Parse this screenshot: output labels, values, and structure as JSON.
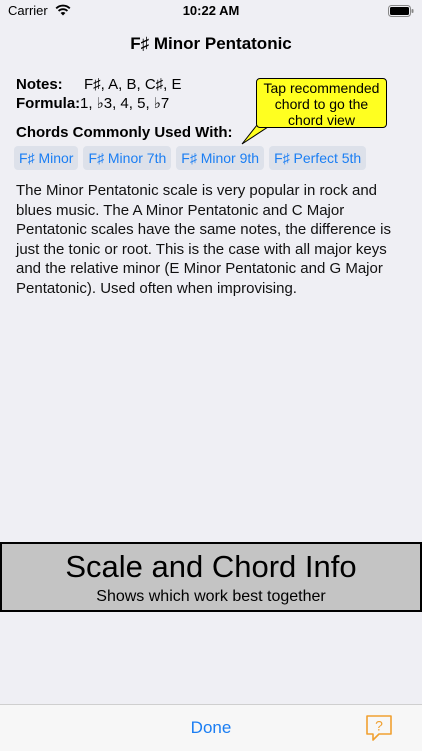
{
  "status_bar": {
    "carrier": "Carrier",
    "time": "10:22 AM",
    "icons": [
      "wifi-icon",
      "battery-icon"
    ]
  },
  "page": {
    "title": "F♯ Minor Pentatonic"
  },
  "scale_info": {
    "notes_label": "Notes:",
    "notes_value": "F♯, A, B, C♯, E",
    "formula_label": "Formula:",
    "formula_value": "1, ♭3, 4, 5, ♭7"
  },
  "chords": {
    "heading": "Chords Commonly Used With:",
    "items": [
      {
        "label": "F♯ Minor"
      },
      {
        "label": "F♯ Minor 7th"
      },
      {
        "label": "F♯ Minor 9th"
      },
      {
        "label": "F♯ Perfect 5th"
      }
    ],
    "chip_color": "#1b7ef3"
  },
  "tooltip": {
    "lines": [
      "Tap recommended",
      "chord to go the",
      "chord view"
    ],
    "color": "#ffff20"
  },
  "description": "The Minor Pentatonic scale is very popular in rock and blues music. The A Minor Pentatonic and C Major Pentatonic scales have the same notes, the difference is just the tonic or root. This is the case with all major keys and the relative minor (E Minor Pentatonic and G Major Pentatonic). Used often when improvising.",
  "banner": {
    "title": "Scale and Chord Info",
    "subtitle": "Shows which work best together"
  },
  "bottom_bar": {
    "done_label": "Done",
    "help_icon_glyph": "?",
    "accent": "#1b7ef3",
    "help_color": "#f0a030"
  }
}
